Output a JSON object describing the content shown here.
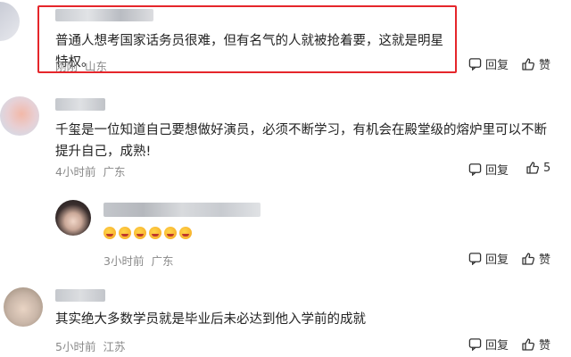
{
  "comments": [
    {
      "text": "普通人想考国家话务员很难，但有名气的人就被抢着要，这就是明星特权。",
      "time": "刚刚",
      "location": "山东",
      "reply_label": "回复",
      "like_label": "赞"
    },
    {
      "text": "千玺是一位知道自己要想做好演员，必须不断学习，有机会在殿堂级的熔炉里可以不断提升自己，成熟!",
      "time": "4小时前",
      "location": "广东",
      "reply_label": "回复",
      "like_count": "5",
      "like_label": "赞"
    },
    {
      "time": "3小时前",
      "location": "广东",
      "reply_label": "回复",
      "like_label": "赞"
    },
    {
      "text": "其实绝大多数学员就是毕业后未必达到他入学前的成就",
      "time": "5小时前",
      "location": "江苏",
      "reply_label": "回复",
      "like_label": "赞"
    }
  ],
  "colors": {
    "highlight_border": "#e5262b",
    "meta_text": "#8a8a8a"
  },
  "icons": {
    "reply": "comment-bubble-icon",
    "like": "thumbs-up-icon"
  }
}
